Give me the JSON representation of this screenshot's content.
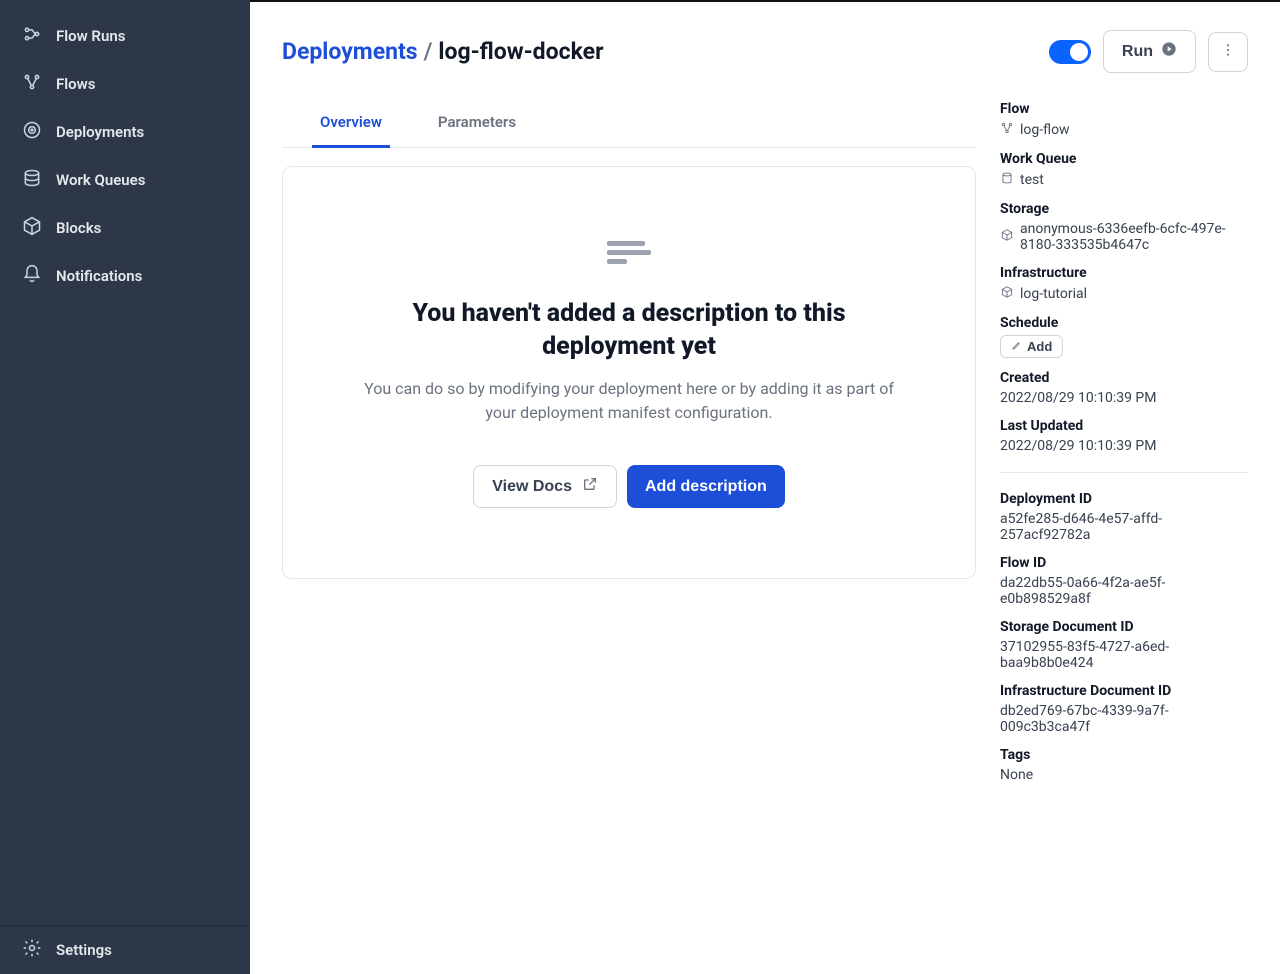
{
  "sidebar": {
    "items": [
      {
        "label": "Flow Runs"
      },
      {
        "label": "Flows"
      },
      {
        "label": "Deployments"
      },
      {
        "label": "Work Queues"
      },
      {
        "label": "Blocks"
      },
      {
        "label": "Notifications"
      }
    ],
    "settings_label": "Settings"
  },
  "header": {
    "breadcrumb_parent": "Deployments",
    "breadcrumb_sep": "/",
    "breadcrumb_current": "log-flow-docker",
    "run_label": "Run"
  },
  "tabs": {
    "overview": "Overview",
    "parameters": "Parameters"
  },
  "empty": {
    "title": "You haven't added a description to this deployment yet",
    "subtitle": "You can do so by modifying your deployment here or by adding it as part of your deployment manifest configuration.",
    "view_docs": "View Docs",
    "add_description": "Add description"
  },
  "details": {
    "flow_label": "Flow",
    "flow_value": "log-flow",
    "work_queue_label": "Work Queue",
    "work_queue_value": "test",
    "storage_label": "Storage",
    "storage_value": "anonymous-6336eefb-6cfc-497e-8180-333535b4647c",
    "infrastructure_label": "Infrastructure",
    "infrastructure_value": "log-tutorial",
    "schedule_label": "Schedule",
    "schedule_add": "Add",
    "created_label": "Created",
    "created_value": "2022/08/29 10:10:39 PM",
    "updated_label": "Last Updated",
    "updated_value": "2022/08/29 10:10:39 PM",
    "deployment_id_label": "Deployment ID",
    "deployment_id_value": "a52fe285-d646-4e57-affd-257acf92782a",
    "flow_id_label": "Flow ID",
    "flow_id_value": "da22db55-0a66-4f2a-ae5f-e0b898529a8f",
    "storage_doc_label": "Storage Document ID",
    "storage_doc_value": "37102955-83f5-4727-a6ed-baa9b8b0e424",
    "infra_doc_label": "Infrastructure Document ID",
    "infra_doc_value": "db2ed769-67bc-4339-9a7f-009c3b3ca47f",
    "tags_label": "Tags",
    "tags_value": "None"
  }
}
